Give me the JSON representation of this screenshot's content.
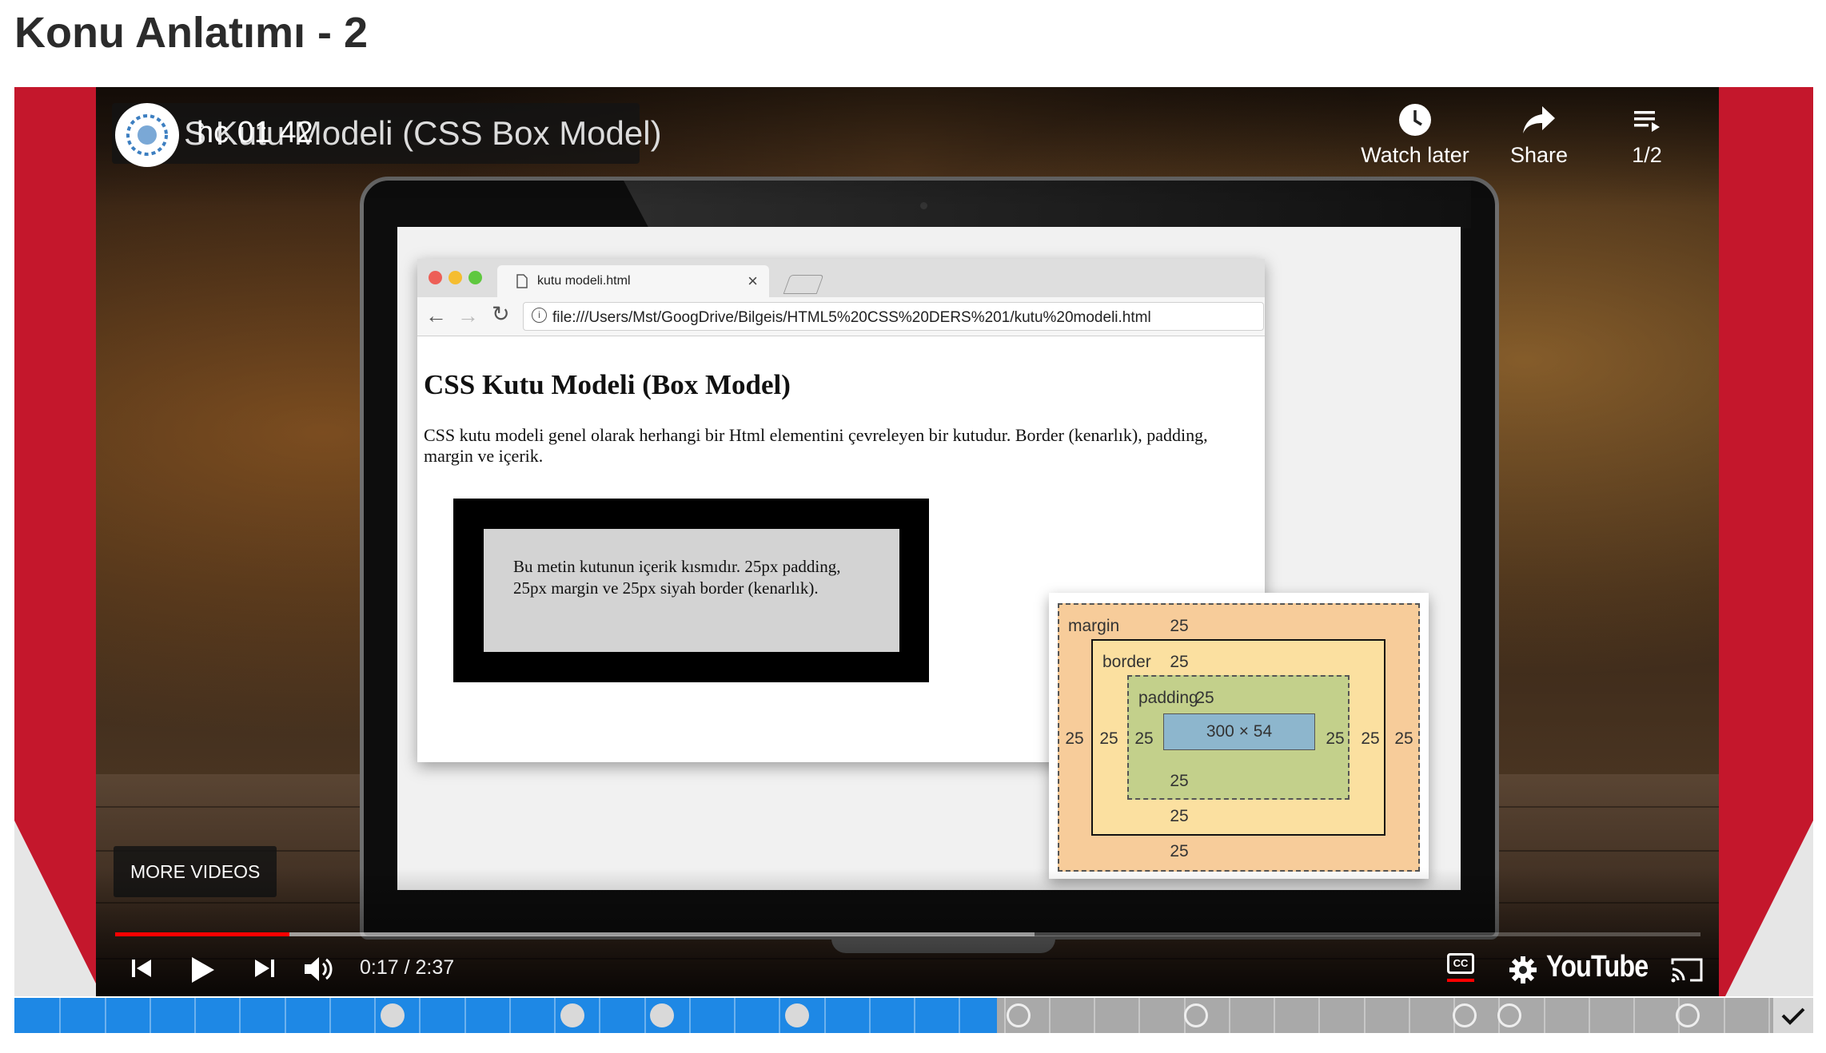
{
  "page": {
    "title": "Konu Anlatımı - 2"
  },
  "video": {
    "overlay_title": "S Kutu Modeli (CSS Box Model)",
    "overlay_title_b": "hc 01 42",
    "watch_later_label": "Watch later",
    "share_label": "Share",
    "playlist_label": "1/2",
    "more_videos_label": "MORE VIDEOS",
    "time_display": "0:17 / 2:37",
    "progress_played": 0.11,
    "progress_loaded": 0.58,
    "youtube_label": "YouTube",
    "cc_label": "CC"
  },
  "browser": {
    "tab_title": "kutu modeli.html",
    "url": "file:///Users/Mst/GoogDrive/Bilgeis/HTML5%20CSS%20DERS%201/kutu%20modeli.html",
    "heading": "CSS Kutu Modeli (Box Model)",
    "paragraph": "CSS kutu modeli genel olarak herhangi bir Html elementini çevreleyen bir kutudur. Border (kenarlık), padding, margin ve içerik.",
    "demo_text": "Bu metin kutunun içerik kısmıdır. 25px padding, 25px margin ve 25px siyah border (kenarlık)."
  },
  "box_model": {
    "margin_label": "margin",
    "border_label": "border",
    "padding_label": "padding",
    "margin_value": "25",
    "border_value": "25",
    "padding_value": "25",
    "content_size": "300 × 54",
    "colors": {
      "margin": "#f7cc9a",
      "border": "#fbe0a0",
      "padding": "#c3d08b",
      "content": "#8db6cd"
    }
  },
  "timeline": {
    "played_fraction": 0.546,
    "segments": 40,
    "filled_markers": [
      0.21,
      0.31,
      0.36,
      0.435
    ],
    "empty_markers": [
      0.558,
      0.657,
      0.806,
      0.831,
      0.93
    ],
    "colors": {
      "played": "#1e88e5",
      "remaining": "#a9a9a9"
    }
  }
}
